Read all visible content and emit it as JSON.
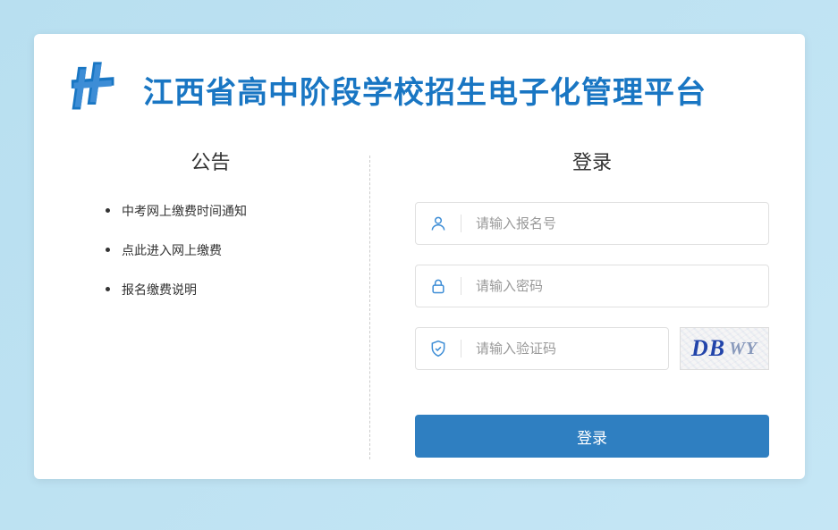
{
  "header": {
    "title": "江西省高中阶段学校招生电子化管理平台"
  },
  "notices": {
    "title": "公告",
    "items": [
      "中考网上缴费时间通知",
      "点此进入网上缴费",
      "报名缴费说明"
    ]
  },
  "login": {
    "title": "登录",
    "username_placeholder": "请输入报名号",
    "password_placeholder": "请输入密码",
    "captcha_placeholder": "请输入验证码",
    "captcha_text_strong": "DB",
    "captcha_text_weak": "WY",
    "submit_label": "登录"
  }
}
